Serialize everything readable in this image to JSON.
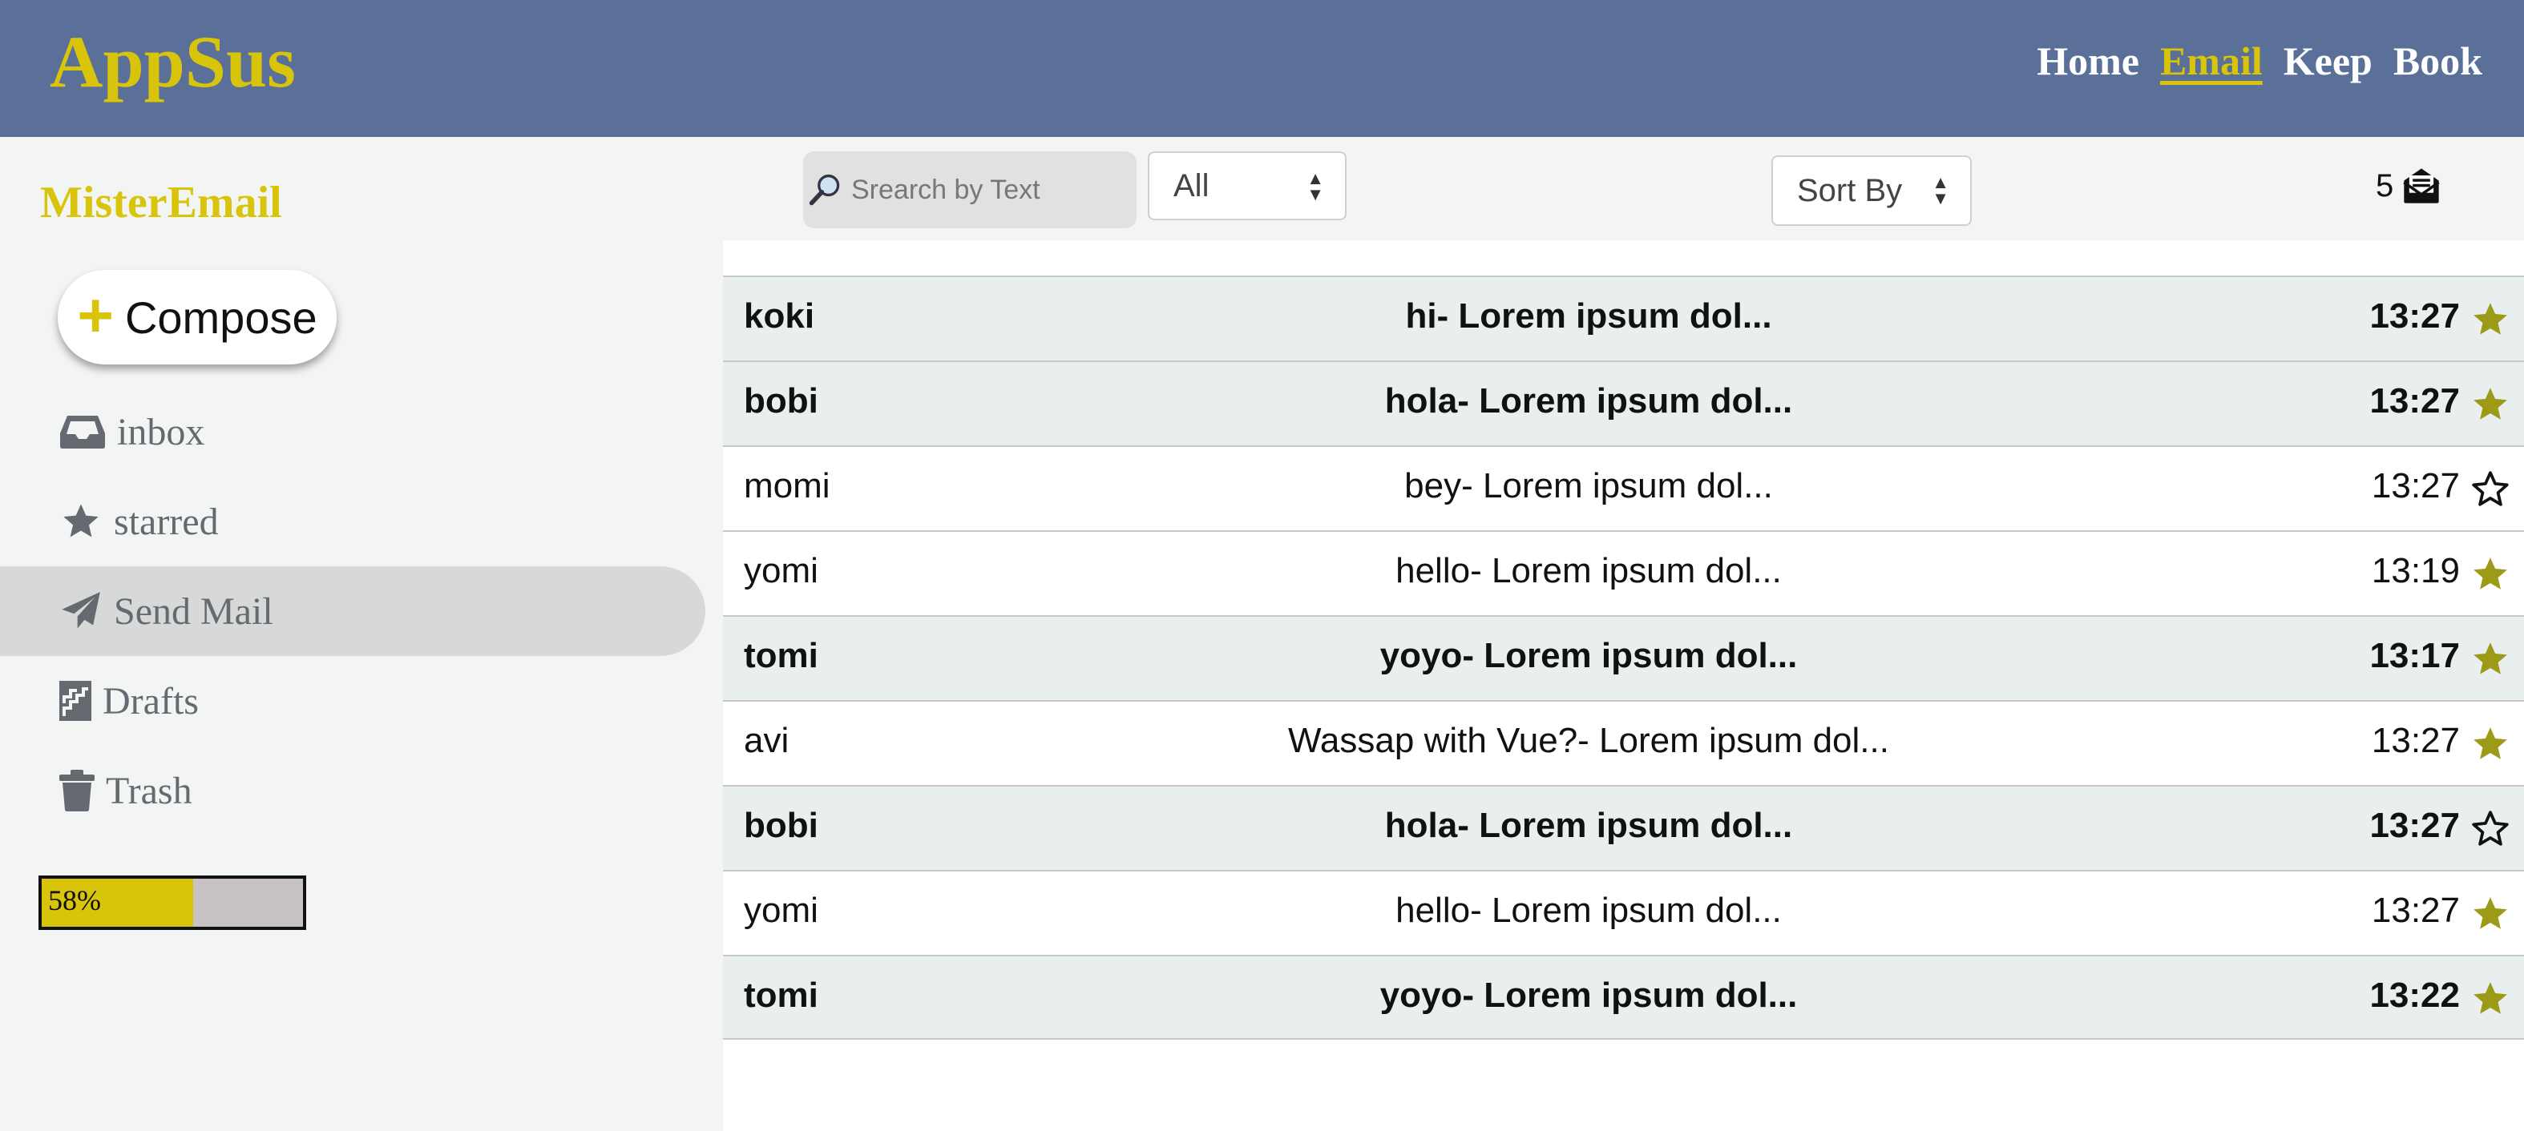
{
  "header": {
    "logo": "AppSus",
    "nav": [
      "Home",
      "Email",
      "Keep",
      "Book"
    ],
    "active_nav": "Email",
    "colors": {
      "background": "#5a7099",
      "accent": "#d8c40a"
    }
  },
  "sidebar": {
    "title": "MisterEmail",
    "compose_label": "Compose",
    "items": [
      {
        "label": "inbox",
        "icon": "inbox-icon"
      },
      {
        "label": "starred",
        "icon": "star-icon"
      },
      {
        "label": "Send Mail",
        "icon": "paper-plane-icon",
        "active": true
      },
      {
        "label": "Drafts",
        "icon": "drafts-icon"
      },
      {
        "label": "Trash",
        "icon": "trash-icon"
      }
    ],
    "progress": {
      "label": "58%",
      "value": 0.58
    }
  },
  "toolbar": {
    "search_placeholder": "Srearch by Text",
    "filter_value": "All",
    "sort_value": "Sort By",
    "unread_count": "5"
  },
  "emails": [
    {
      "from": "koki",
      "subject": "hi- Lorem ipsum dol...",
      "time": "13:27",
      "starred": true,
      "unread": true
    },
    {
      "from": "bobi",
      "subject": "hola- Lorem ipsum dol...",
      "time": "13:27",
      "starred": true,
      "unread": true
    },
    {
      "from": "momi",
      "subject": "bey- Lorem ipsum dol...",
      "time": "13:27",
      "starred": false,
      "unread": false
    },
    {
      "from": "yomi",
      "subject": "hello- Lorem ipsum dol...",
      "time": "13:19",
      "starred": true,
      "unread": false
    },
    {
      "from": "tomi",
      "subject": "yoyo- Lorem ipsum dol...",
      "time": "13:17",
      "starred": true,
      "unread": true
    },
    {
      "from": "avi",
      "subject": "Wassap with Vue?- Lorem ipsum dol...",
      "time": "13:27",
      "starred": true,
      "unread": false
    },
    {
      "from": "bobi",
      "subject": "hola- Lorem ipsum dol...",
      "time": "13:27",
      "starred": false,
      "unread": true
    },
    {
      "from": "yomi",
      "subject": "hello- Lorem ipsum dol...",
      "time": "13:27",
      "starred": true,
      "unread": false
    },
    {
      "from": "tomi",
      "subject": "yoyo- Lorem ipsum dol...",
      "time": "13:22",
      "starred": true,
      "unread": true
    }
  ],
  "colors": {
    "star": "#9c9a16",
    "unread_row": "#e8efee"
  }
}
